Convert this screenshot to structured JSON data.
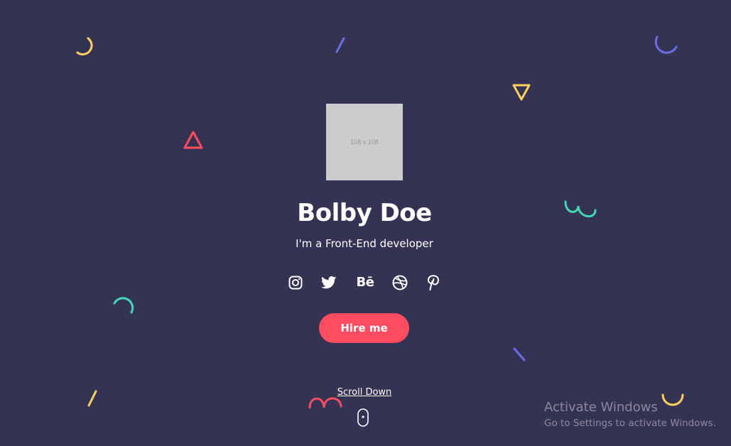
{
  "hero": {
    "avatar_placeholder": "108 x 108",
    "name": "Bolby Doe",
    "subtitle": "I'm a Front-End developer",
    "hire_button_label": "Hire me",
    "scroll_down_label": "Scroll Down"
  },
  "socials": [
    {
      "icon": "instagram-icon"
    },
    {
      "icon": "twitter-icon"
    },
    {
      "icon": "behance-icon",
      "glyph": "Bē"
    },
    {
      "icon": "dribbble-icon"
    },
    {
      "icon": "pinterest-icon"
    }
  ],
  "colors": {
    "background": "#353353",
    "accent": "#ff4c60",
    "yellow": "#ffd15c",
    "purple": "#6c6ce5",
    "teal": "#44d7b6",
    "white": "#ffffff"
  },
  "os_overlay": {
    "title": "Activate Windows",
    "subtitle": "Go to Settings to activate Windows."
  }
}
